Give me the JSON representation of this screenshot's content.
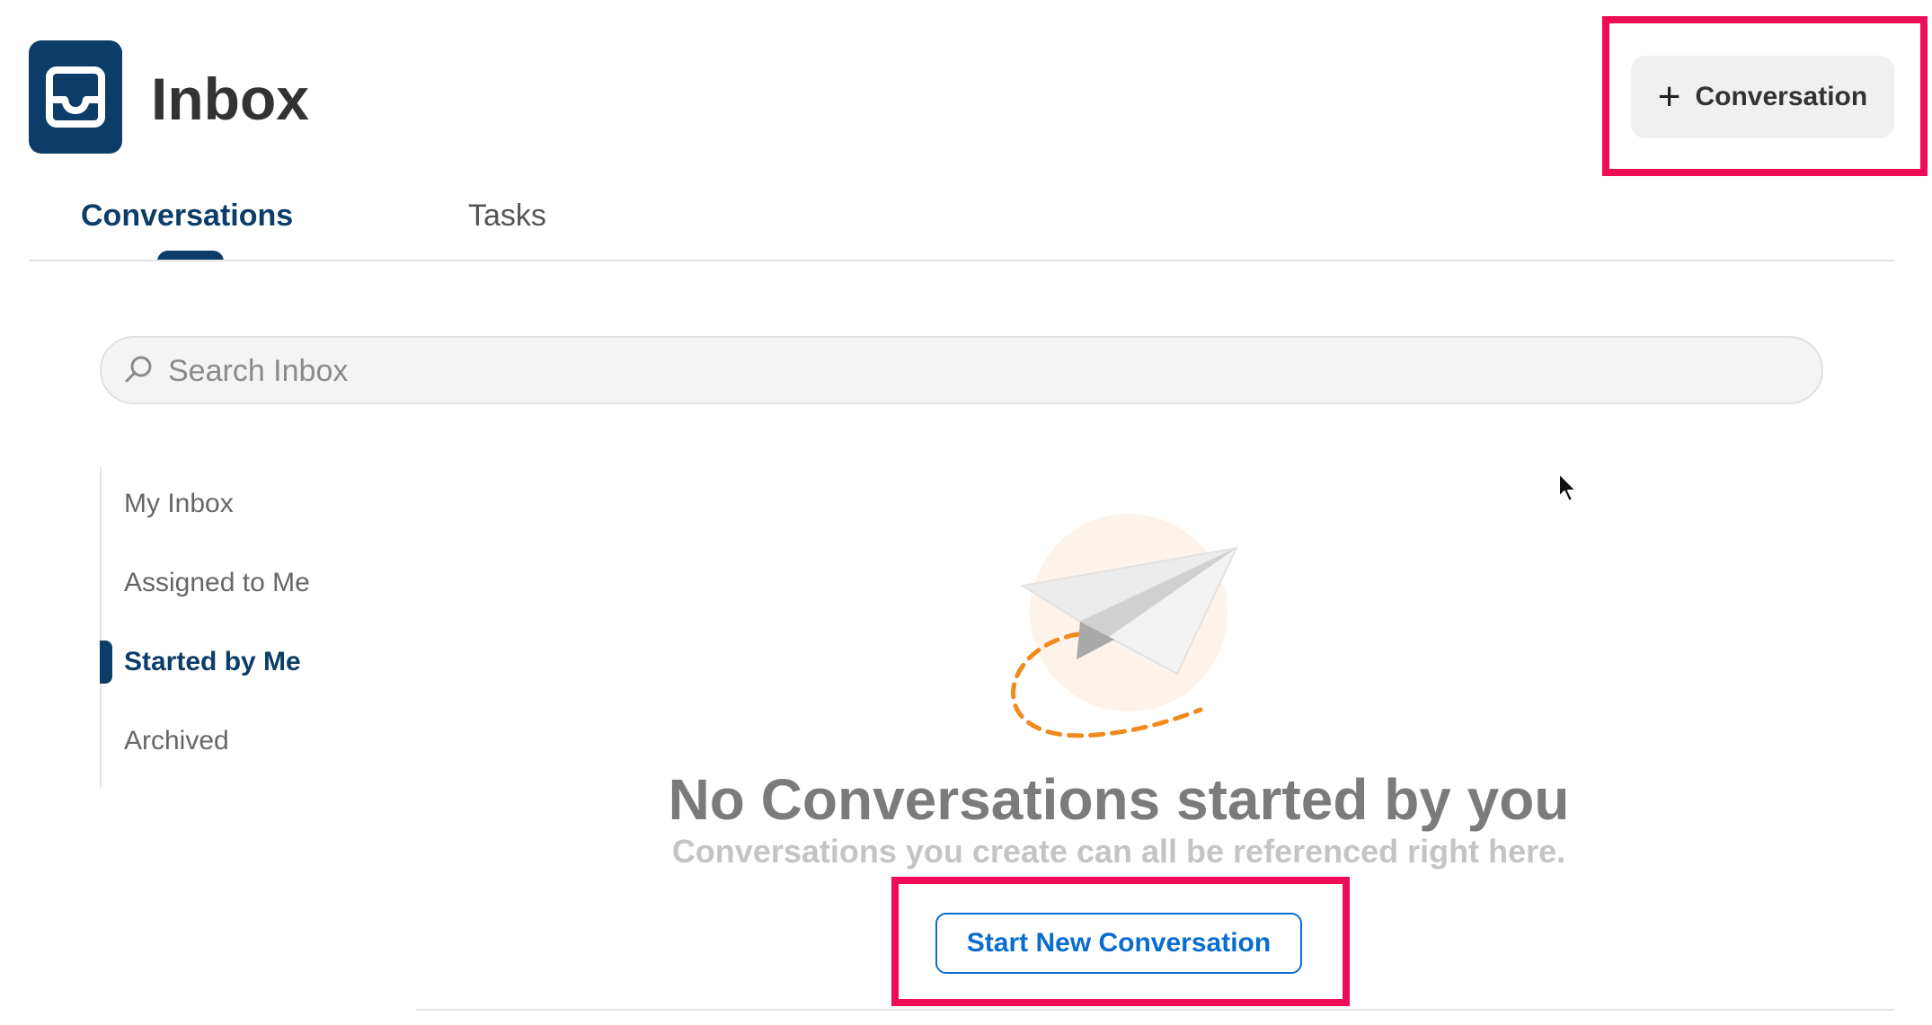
{
  "header": {
    "title": "Inbox",
    "icon": "inbox-tray-icon",
    "new_conversation_label": "Conversation",
    "new_conversation_icon": "plus-icon"
  },
  "tabs": [
    {
      "label": "Conversations",
      "active": true
    },
    {
      "label": "Tasks",
      "active": false
    }
  ],
  "search": {
    "placeholder": "Search Inbox",
    "value": "",
    "icon": "search-icon"
  },
  "sidebar": {
    "items": [
      {
        "label": "My Inbox",
        "active": false
      },
      {
        "label": "Assigned to Me",
        "active": false
      },
      {
        "label": "Started by Me",
        "active": true
      },
      {
        "label": "Archived",
        "active": false
      }
    ]
  },
  "empty_state": {
    "illustration": "paper-plane-icon",
    "title": "No Conversations started by you",
    "subtitle": "Conversations you create can all be referenced right here.",
    "button_label": "Start New Conversation"
  },
  "colors": {
    "brand": "#0c3d68",
    "link": "#0a6ccf",
    "highlight": "#ee0d55",
    "accent_orange": "#f08a1c"
  }
}
